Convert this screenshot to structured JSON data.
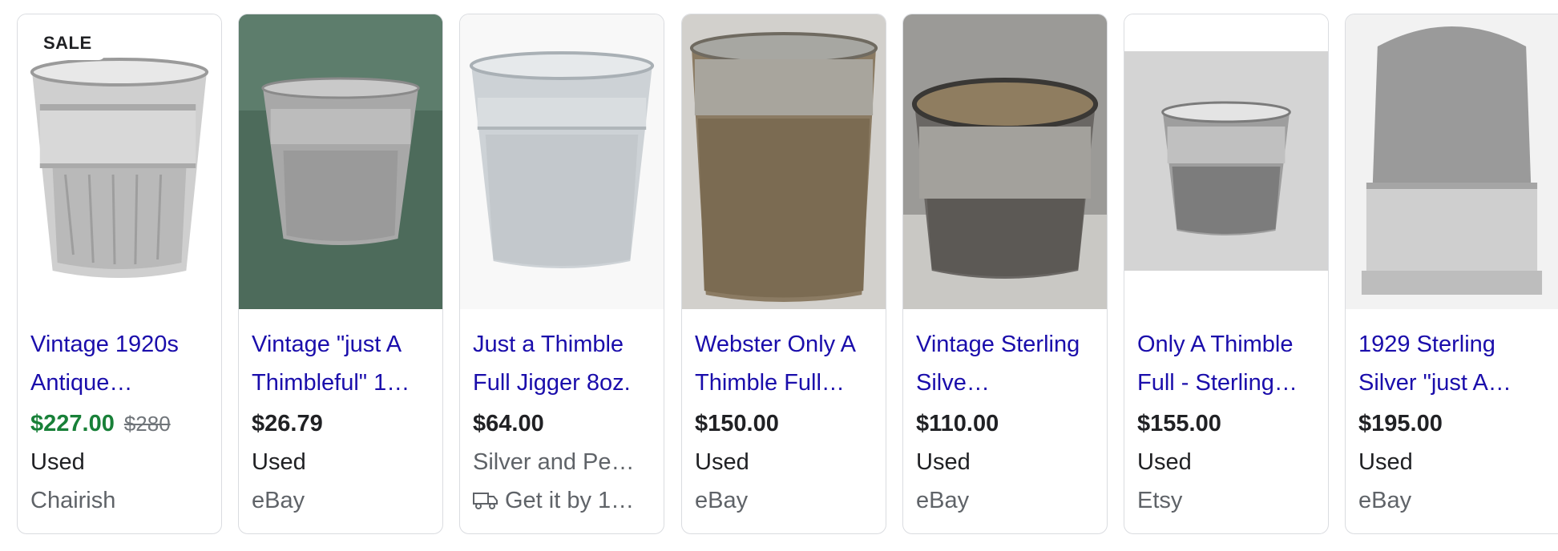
{
  "products": [
    {
      "badge": "SALE",
      "image_icon": "thimble-cup-photo",
      "title": "Vintage 1920s Antique…",
      "price": "$227.00",
      "old_price": "$280",
      "condition": "Used",
      "store": "Chairish",
      "price_color": "#188038"
    },
    {
      "image_icon": "thimble-cup-photo",
      "title": "Vintage \"just A Thimbleful\" 1…",
      "price": "$26.79",
      "condition": "Used",
      "store": "eBay"
    },
    {
      "image_icon": "thimble-cup-photo",
      "title": "Just a Thimble Full Jigger 8oz.",
      "price": "$64.00",
      "condition": "Silver and Pe…",
      "shipping": "Get it by 1…",
      "shipping_icon": "truck-icon"
    },
    {
      "image_icon": "thimble-cup-photo",
      "title": "Webster Only A Thimble Full…",
      "price": "$150.00",
      "condition": "Used",
      "store": "eBay"
    },
    {
      "image_icon": "thimble-cup-photo",
      "title": "Vintage Sterling Silve…",
      "price": "$110.00",
      "condition": "Used",
      "store": "eBay"
    },
    {
      "image_icon": "thimble-cup-photo",
      "title": "Only A Thimble Full - Sterling…",
      "price": "$155.00",
      "condition": "Used",
      "store": "Etsy"
    },
    {
      "image_icon": "thimble-cup-photo",
      "title": "1929 Sterling Silver \"just A…",
      "price": "$195.00",
      "condition": "Used",
      "store": "eBay"
    }
  ],
  "colors": {
    "title_link": "#1a0dab",
    "text": "#202124",
    "muted": "#5f6368",
    "border": "#dadce0"
  }
}
